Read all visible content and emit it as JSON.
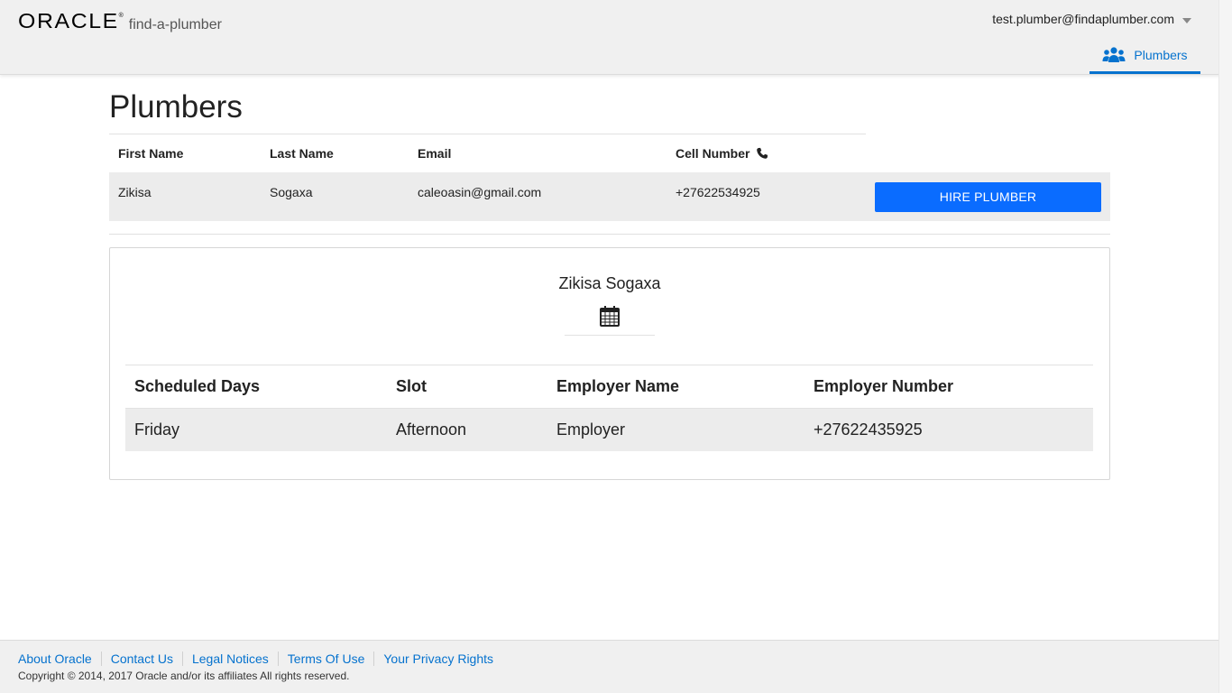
{
  "header": {
    "logo_text": "ORACLE",
    "logo_mark": "®",
    "app_name": "find-a-plumber",
    "user_email": "test.plumber@findaplumber.com",
    "nav_tab_label": "Plumbers",
    "nav_tab_icon": "people-icon",
    "accent_color": "#0572ce"
  },
  "main": {
    "page_title": "Plumbers",
    "plumber_table": {
      "columns": [
        "First Name",
        "Last Name",
        "Email",
        "Cell Number"
      ],
      "rows": [
        {
          "first_name": "Zikisa",
          "last_name": "Sogaxa",
          "email": "caleoasin@gmail.com",
          "cell_number": "+27622534925",
          "action_label": "HIRE PLUMBER"
        }
      ]
    },
    "schedule_card": {
      "plumber_name": "Zikisa Sogaxa",
      "icon": "calendar-icon",
      "columns": [
        "Scheduled Days",
        "Slot",
        "Employer Name",
        "Employer Number"
      ],
      "rows": [
        {
          "day": "Friday",
          "slot": "Afternoon",
          "employer_name": "Employer",
          "employer_number": "+27622435925"
        }
      ]
    }
  },
  "footer": {
    "links": [
      "About Oracle",
      "Contact Us",
      "Legal Notices",
      "Terms Of Use",
      "Your Privacy Rights"
    ],
    "copyright": "Copyright © 2014, 2017 Oracle and/or its affiliates All rights reserved."
  },
  "colors": {
    "button_bg": "#0a6cff",
    "header_bg": "#f0f0f0",
    "row_bg": "#ececec"
  }
}
